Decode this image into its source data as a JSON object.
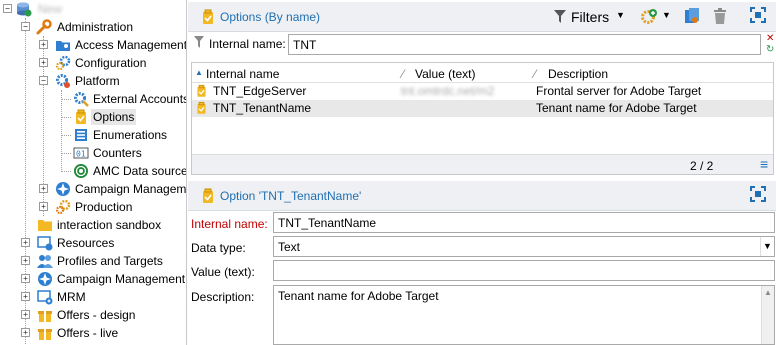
{
  "tree": {
    "root_label": "New",
    "items": [
      {
        "label": "Administration"
      },
      {
        "label": "Access Management"
      },
      {
        "label": "Configuration"
      },
      {
        "label": "Platform"
      },
      {
        "label": "External Accounts"
      },
      {
        "label": "Options"
      },
      {
        "label": "Enumerations"
      },
      {
        "label": "Counters"
      },
      {
        "label": "AMC Data sources"
      },
      {
        "label": "Campaign Management"
      },
      {
        "label": "Production"
      },
      {
        "label": "interaction sandbox"
      },
      {
        "label": "Resources"
      },
      {
        "label": "Profiles and Targets"
      },
      {
        "label": "Campaign Management"
      },
      {
        "label": "MRM"
      },
      {
        "label": "Offers - design"
      },
      {
        "label": "Offers - live"
      }
    ]
  },
  "list_panel": {
    "title": "Options (By name)",
    "filters_label": "Filters",
    "filter_label": "Internal name:",
    "filter_value": "TNT",
    "columns": [
      "Internal name",
      "Value (text)",
      "Description"
    ],
    "rows": [
      {
        "name": "TNT_EdgeServer",
        "value": "tnt.omtrdc.net/m2",
        "description": "Frontal server for Adobe Target"
      },
      {
        "name": "TNT_TenantName",
        "value": "",
        "description": "Tenant name for Adobe Target"
      }
    ],
    "count": "2 / 2"
  },
  "detail_panel": {
    "title": "Option 'TNT_TenantName'",
    "internal_name_label": "Internal name:",
    "internal_name_value": "TNT_TenantName",
    "data_type_label": "Data type:",
    "data_type_value": "Text",
    "value_label": "Value (text):",
    "value_value": "",
    "description_label": "Description:",
    "description_value": "Tenant name for Adobe Target"
  },
  "colors": {
    "accent": "#1f6fb2",
    "required_label": "#c00000",
    "folder_yellow": "#f2b925",
    "header_bg": "#eef0f3"
  }
}
